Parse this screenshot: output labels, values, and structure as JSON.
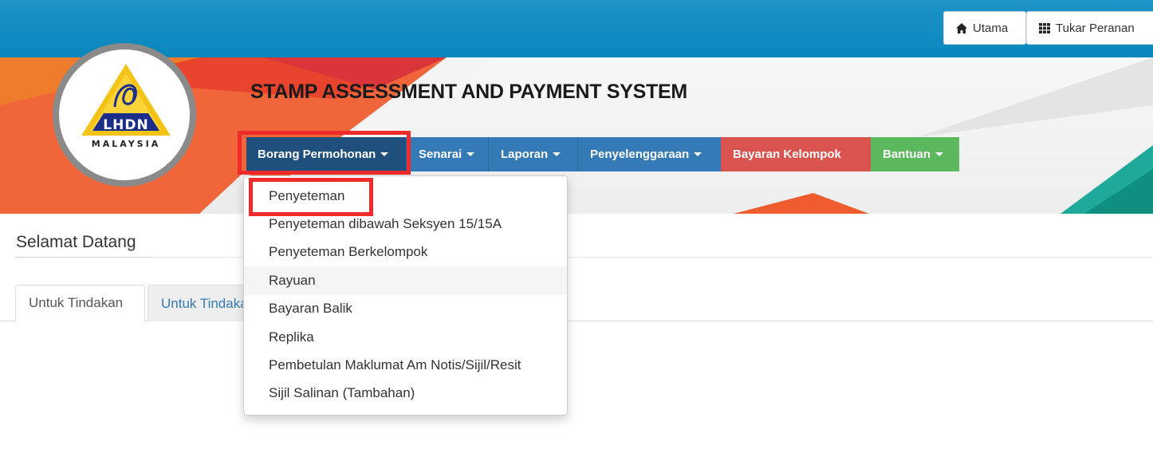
{
  "topbar": {
    "utama_label": "Utama",
    "utama_icon": "home-icon",
    "tukar_label": "Tukar Peranan",
    "tukar_icon": "grid-icon",
    "bg_color": "#0a87bd"
  },
  "banner": {
    "title": "STAMP ASSESSMENT AND PAYMENT SYSTEM",
    "logo": {
      "text_top": "LHDN",
      "text_bottom": "MALAYSIA"
    }
  },
  "nav": {
    "items": [
      {
        "label": "Borang Permohonan",
        "color": "#1f4f7c",
        "has_caret": true
      },
      {
        "label": "Senarai",
        "color": "#337ab7",
        "has_caret": true
      },
      {
        "label": "Laporan",
        "color": "#337ab7",
        "has_caret": true
      },
      {
        "label": "Penyelenggaraan",
        "color": "#337ab7",
        "has_caret": true
      },
      {
        "label": "Bayaran Kelompok",
        "color": "#d9534f",
        "has_caret": false
      },
      {
        "label": "Bantuan",
        "color": "#5cb85c",
        "has_caret": true
      }
    ],
    "highlight_color": "#ef2b2b"
  },
  "dropdown": {
    "items": [
      {
        "label": "Penyeteman"
      },
      {
        "label": "Penyeteman dibawah Seksyen 15/15A"
      },
      {
        "label": "Penyeteman Berkelompok"
      },
      {
        "label": "Rayuan"
      },
      {
        "label": "Bayaran Balik"
      },
      {
        "label": "Replika"
      },
      {
        "label": "Pembetulan Maklumat Am Notis/Sijil/Resit"
      },
      {
        "label": "Sijil Salinan (Tambahan)"
      }
    ]
  },
  "main": {
    "welcome": "Selamat Datang",
    "tabs": [
      {
        "label": "Untuk Tindakan",
        "active": true
      },
      {
        "label": "Untuk Tindakan",
        "active": false
      }
    ]
  }
}
